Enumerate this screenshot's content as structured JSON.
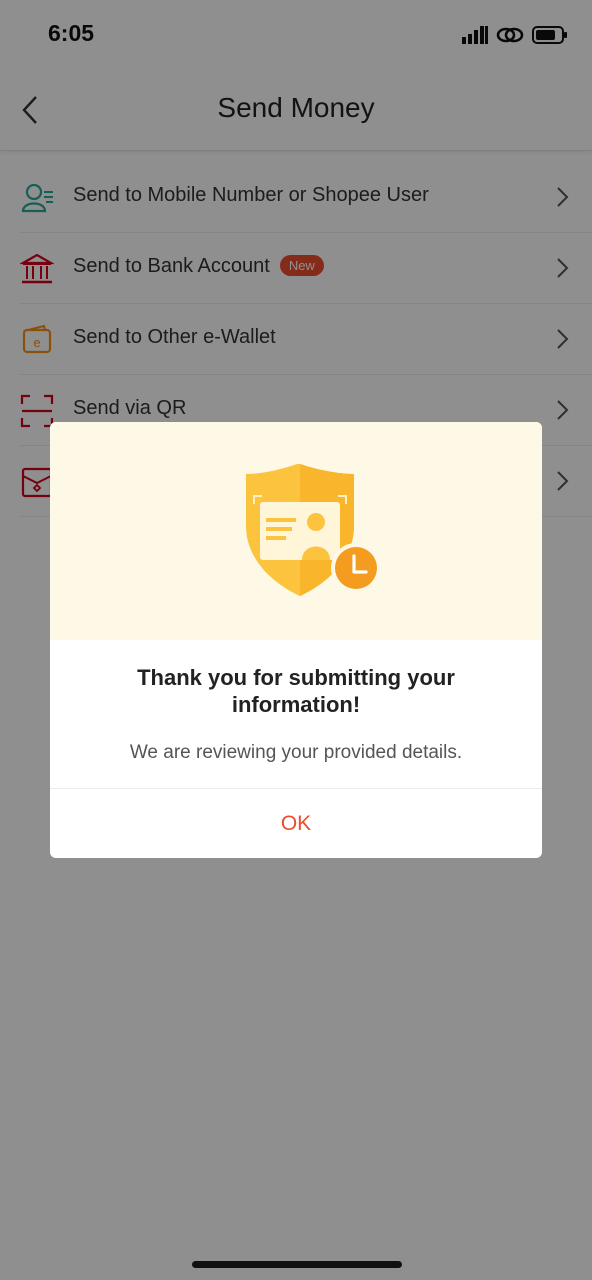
{
  "status_bar": {
    "time": "6:05"
  },
  "header": {
    "title": "Send Money",
    "back_icon": "chevron-left-icon"
  },
  "menu": {
    "items": [
      {
        "label": "Send to Mobile Number or Shopee User",
        "icon": "contact-user-icon",
        "badge": ""
      },
      {
        "label": "Send to Bank Account",
        "icon": "bank-icon",
        "badge": "New"
      },
      {
        "label": "Send to Other e-Wallet",
        "icon": "wallet-icon",
        "badge": ""
      },
      {
        "label": "Send via QR",
        "icon": "qr-scan-icon",
        "badge": ""
      },
      {
        "label": "",
        "icon": "red-envelope-icon",
        "badge": ""
      }
    ]
  },
  "dialog": {
    "title": "Thank you for submitting your information!",
    "message": "We are reviewing your provided details.",
    "ok_label": "OK",
    "illustration": "shield-id-clock-icon"
  },
  "colors": {
    "accent": "#ee4d2d",
    "teal_icon": "#26aa99",
    "bank_icon": "#d0011b",
    "wallet_icon": "#f69113",
    "hero_bg": "#fef8e6",
    "shield_yellow": "#fcc43e",
    "clock_orange": "#f39c1f"
  }
}
